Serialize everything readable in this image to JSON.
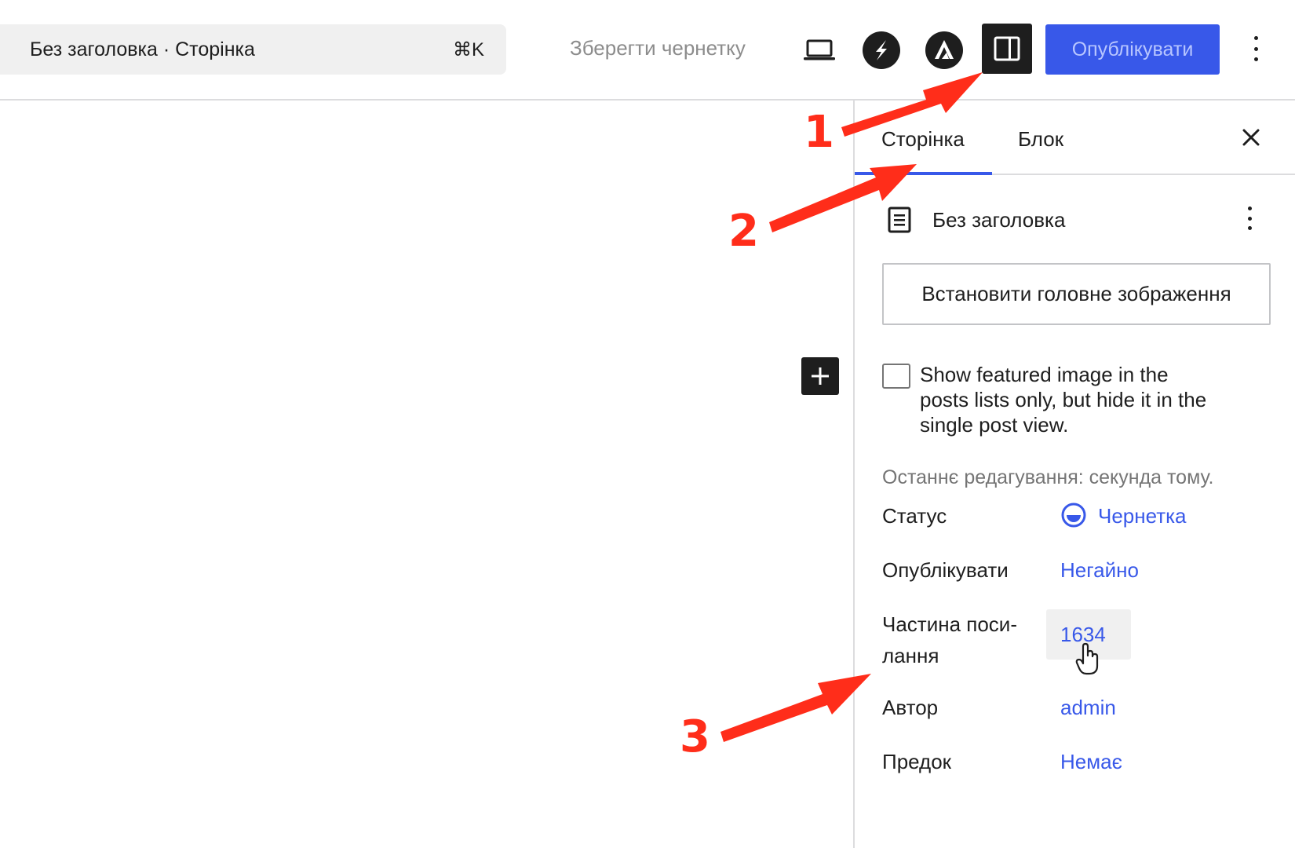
{
  "header": {
    "command_bar": {
      "title": "Без заголовка · Сторінка",
      "shortcut": "⌘K"
    },
    "save_draft_label": "Зберегти чернетку",
    "publish_label": "Опублікувати",
    "icons": [
      "laptop-preview-icon",
      "s-plugin-icon",
      "a-plugin-icon",
      "settings-sidebar-icon",
      "more-vertical-icon"
    ]
  },
  "sidebar": {
    "tabs": [
      {
        "label": "Сторінка",
        "active": true
      },
      {
        "label": "Блок",
        "active": false
      }
    ],
    "document_title": "Без заголовка",
    "featured_image_button": "Встановити головне зображення",
    "checkbox_label": "Show featured image in the posts lists only, but hide it in the single post view.",
    "last_edited": "Останнє редагування: секунда тому.",
    "rows": [
      {
        "label": "Статус",
        "value": "Чернетка"
      },
      {
        "label": "Опублікувати",
        "value": "Негайно"
      },
      {
        "label": "Частина поси-\nлання",
        "value": "1634"
      },
      {
        "label": "Автор",
        "value": "admin"
      },
      {
        "label": "Предок",
        "value": "Немає"
      }
    ]
  },
  "annotations": [
    "1",
    "2",
    "3"
  ],
  "colors": {
    "accent": "#3858e9",
    "annotation": "#ff2d1a",
    "dark": "#1e1e1e"
  }
}
